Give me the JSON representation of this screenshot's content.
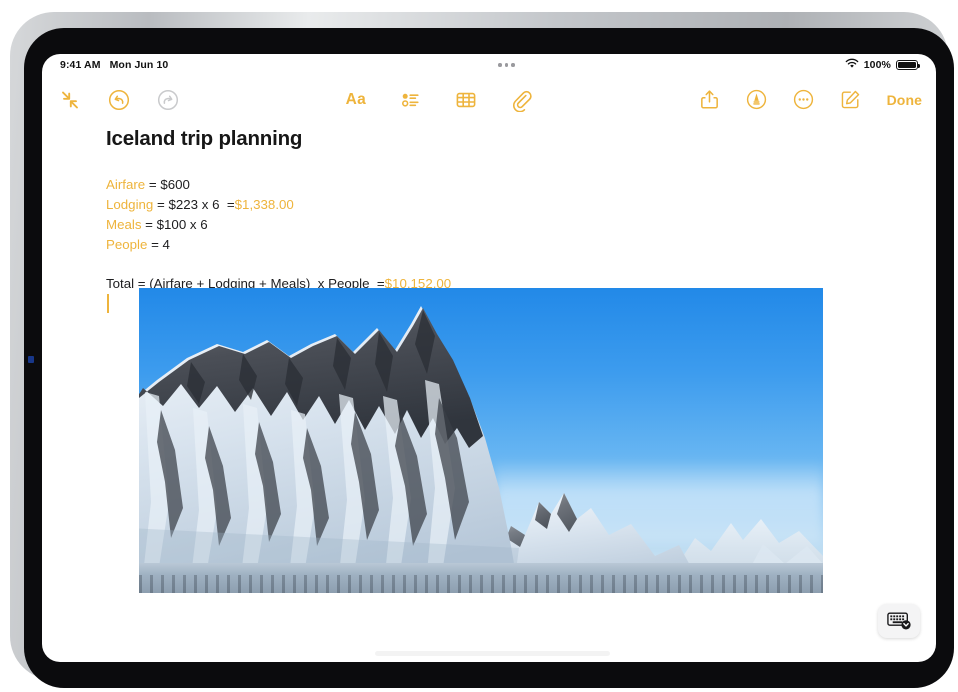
{
  "device": {
    "name": "ipad"
  },
  "status_bar": {
    "time": "9:41 AM",
    "date": "Mon Jun 10",
    "battery_percent": "100%",
    "wifi_icon": "wifi-icon",
    "battery_icon": "battery-full-icon",
    "multitask_icon": "multitasking-dots-icon"
  },
  "toolbar": {
    "left": [
      {
        "name": "collapse-icon",
        "label": "Collapse",
        "state": "enabled"
      },
      {
        "name": "undo-icon",
        "label": "Undo",
        "state": "enabled"
      },
      {
        "name": "redo-icon",
        "label": "Redo",
        "state": "disabled"
      }
    ],
    "center": [
      {
        "name": "format-text-icon",
        "label": "Aa"
      },
      {
        "name": "checklist-icon",
        "label": "Checklist"
      },
      {
        "name": "table-icon",
        "label": "Table"
      },
      {
        "name": "attachment-paperclip-icon",
        "label": "Attach"
      }
    ],
    "right": [
      {
        "name": "share-icon",
        "label": "Share"
      },
      {
        "name": "markup-pen-icon",
        "label": "Markup"
      },
      {
        "name": "more-ellipsis-icon",
        "label": "More"
      },
      {
        "name": "compose-icon",
        "label": "New Note"
      }
    ],
    "done_label": "Done"
  },
  "note": {
    "title": "Iceland trip planning",
    "calc_lines": [
      {
        "var": "Airfare",
        "expr": " = $600",
        "result": ""
      },
      {
        "var": "Lodging",
        "expr": " = $223 x 6  =",
        "result": "$1,338.00"
      },
      {
        "var": "Meals",
        "expr": " = $100 x 6",
        "result": ""
      },
      {
        "var": "People",
        "expr": " = 4",
        "result": ""
      }
    ],
    "total_expr": "Total = (Airfare + Lodging + Meals)  x People  =",
    "total_result": "$10,152.00",
    "photo_alt": "Snow-covered mountain ridge under a clear blue sky"
  },
  "keyboard_dismiss": {
    "name": "keyboard-dismiss-icon",
    "label": "Hide Keyboard"
  },
  "colors": {
    "accent_yellow": "#EEB43C",
    "disabled_gray": "#C9CACC",
    "text_black": "#1d1d1f",
    "sky_blue": "#2289e8"
  }
}
